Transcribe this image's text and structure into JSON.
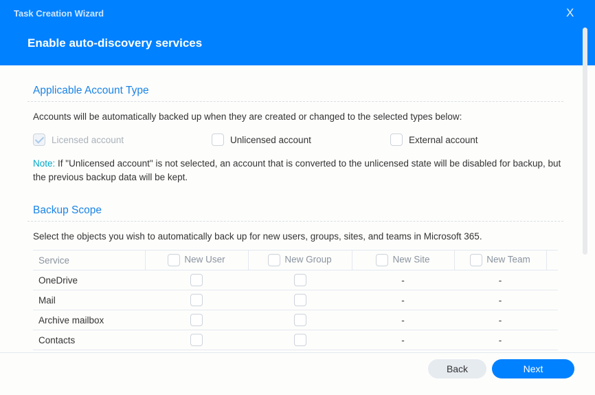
{
  "window": {
    "title": "Task Creation Wizard",
    "close": "X"
  },
  "page_title": "Enable auto-discovery services",
  "account_type": {
    "heading": "Applicable Account Type",
    "description": "Accounts will be automatically backed up when they are created or changed to the selected types below:",
    "options": [
      {
        "label": "Licensed account",
        "checked": true,
        "disabled": true
      },
      {
        "label": "Unlicensed account",
        "checked": false
      },
      {
        "label": "External account",
        "checked": false
      }
    ],
    "note_label": "Note:",
    "note_text": " If \"Unlicensed account\" is not selected, an account that is converted to the unlicensed state will be disabled for backup, but the previous backup data will be kept."
  },
  "backup_scope": {
    "heading": "Backup Scope",
    "description": "Select the objects you wish to automatically back up for new users, groups, sites, and teams in Microsoft 365.",
    "columns": [
      "Service",
      "New User",
      "New Group",
      "New Site",
      "New Team"
    ],
    "rows": [
      {
        "service": "OneDrive",
        "site": "-",
        "team": "-"
      },
      {
        "service": "Mail",
        "site": "-",
        "team": "-"
      },
      {
        "service": "Archive mailbox",
        "site": "-",
        "team": "-"
      },
      {
        "service": "Contacts",
        "site": "-",
        "team": "-"
      }
    ]
  },
  "buttons": {
    "back": "Back",
    "next": "Next"
  }
}
